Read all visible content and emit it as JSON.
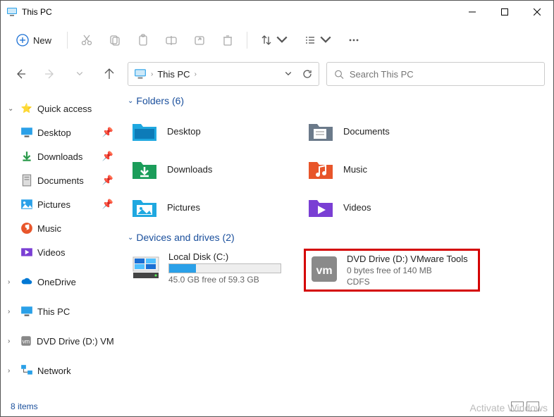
{
  "window": {
    "title": "This PC"
  },
  "toolbar": {
    "new_label": "New"
  },
  "address": {
    "crumb": "This PC",
    "search_placeholder": "Search This PC"
  },
  "sidebar": {
    "quick_access": "Quick access",
    "desktop": "Desktop",
    "downloads": "Downloads",
    "documents": "Documents",
    "pictures": "Pictures",
    "music": "Music",
    "videos": "Videos",
    "onedrive": "OneDrive",
    "thispc": "This PC",
    "dvd": "DVD Drive (D:) VMw",
    "network": "Network"
  },
  "sections": {
    "folders_header": "Folders (6)",
    "drives_header": "Devices and drives (2)"
  },
  "folders": {
    "desktop": "Desktop",
    "documents": "Documents",
    "downloads": "Downloads",
    "music": "Music",
    "pictures": "Pictures",
    "videos": "Videos"
  },
  "drives": {
    "local": {
      "name": "Local Disk (C:)",
      "free": "45.0 GB free of 59.3 GB",
      "fill_pct": 24
    },
    "dvd": {
      "name": "DVD Drive (D:) VMware Tools",
      "free": "0 bytes free of 140 MB",
      "fs": "CDFS"
    }
  },
  "status": {
    "items": "8 items",
    "watermark": "Activate Windows"
  }
}
